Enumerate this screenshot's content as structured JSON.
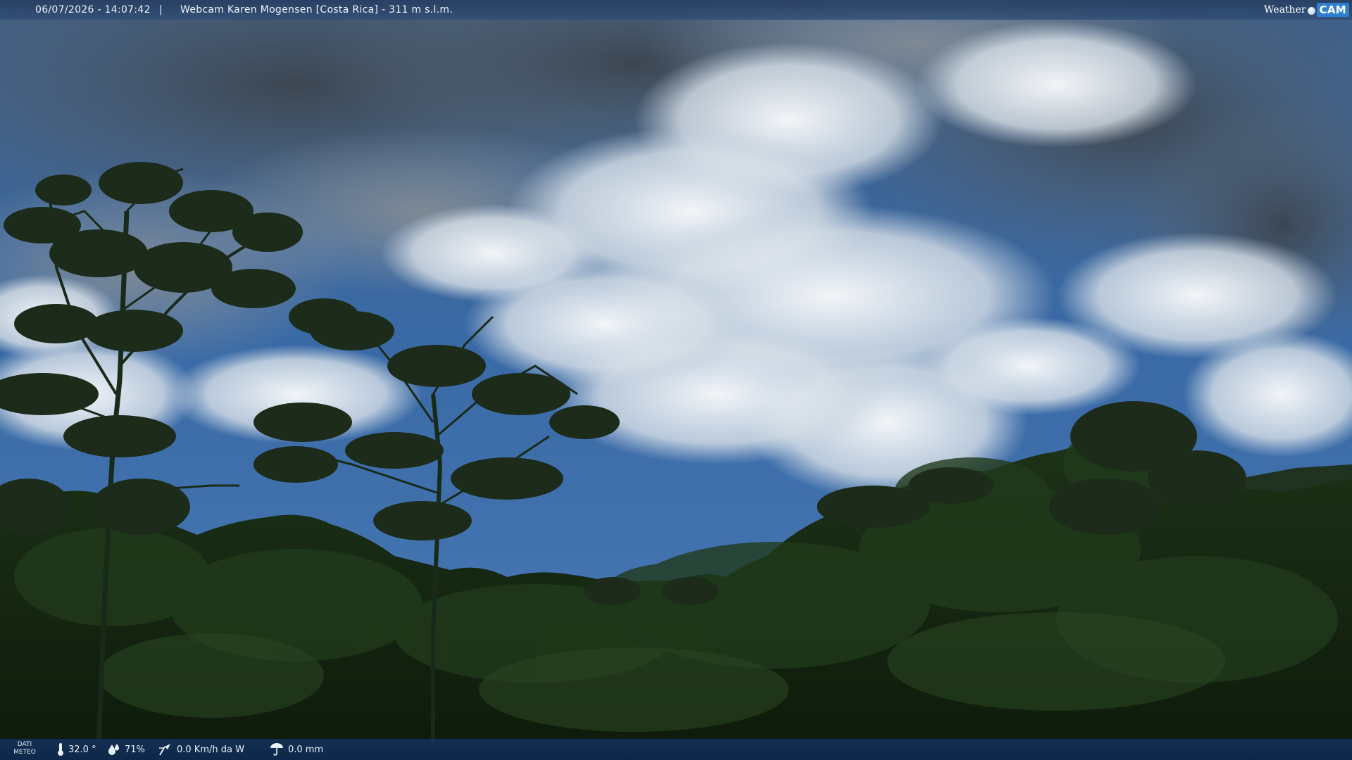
{
  "overlay": {
    "datetime": "06/07/2026 - 14:07:42",
    "separator": "|",
    "title": "Webcam Karen Mogensen [Costa Rica]  - 311 m s.l.m.",
    "brand_weather": "Weather",
    "brand_cam": "CAM"
  },
  "weather": {
    "label_line1": "DATI",
    "label_line2": "METEO",
    "temperature": "32.0 °",
    "humidity": "71%",
    "wind": "0.0 Km/h da W",
    "rain": "0.0 mm"
  },
  "colors": {
    "sky_blue": "#3e6fa8",
    "cloud_white": "#e9eef3",
    "cloud_grey": "#4a5562",
    "forest_dark": "#15240f",
    "bar_blue": "#1a3a66"
  },
  "icons": [
    "thermometer-icon",
    "humidity-drops-icon",
    "wind-vane-icon",
    "rain-gauge-icon",
    "weathercam-logo"
  ]
}
